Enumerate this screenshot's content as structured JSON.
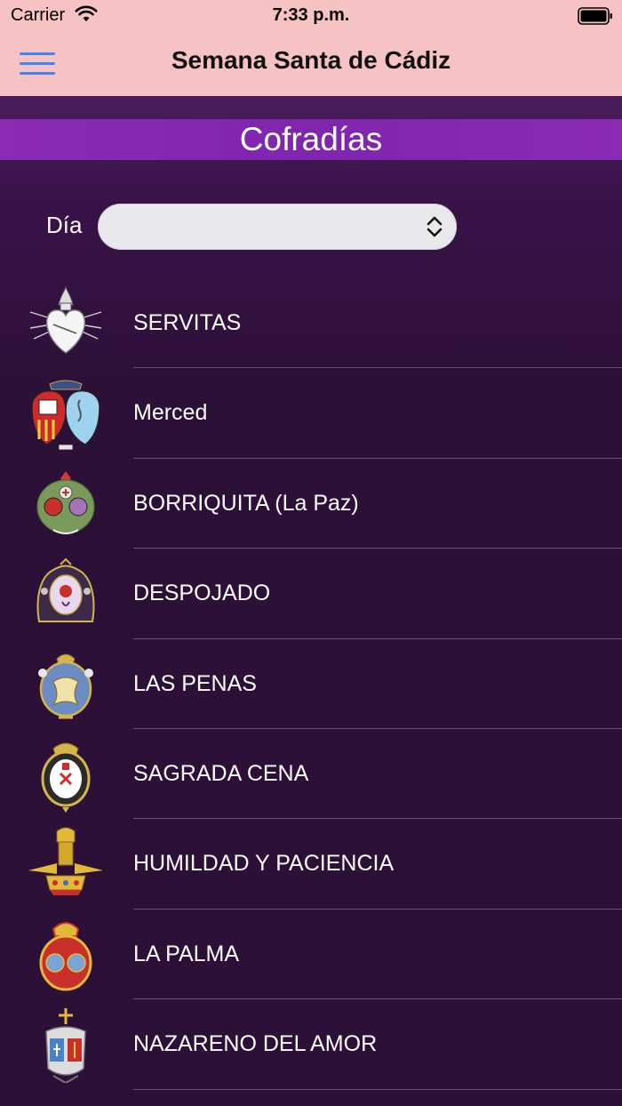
{
  "status_bar": {
    "carrier": "Carrier",
    "time": "7:33 p.m."
  },
  "header": {
    "title": "Semana Santa de Cádiz",
    "menu_icon": "hamburger-menu-icon"
  },
  "section": {
    "title": "Cofradías"
  },
  "filter": {
    "label": "Día",
    "selected": ""
  },
  "cofradias": [
    {
      "name": "SERVITAS",
      "icon": "servitas-emblem-icon"
    },
    {
      "name": "Merced",
      "icon": "merced-emblem-icon"
    },
    {
      "name": "BORRIQUITA (La Paz)",
      "icon": "borriquita-emblem-icon"
    },
    {
      "name": "DESPOJADO",
      "icon": "despojado-emblem-icon"
    },
    {
      "name": "LAS PENAS",
      "icon": "las-penas-emblem-icon"
    },
    {
      "name": "SAGRADA CENA",
      "icon": "sagrada-cena-emblem-icon"
    },
    {
      "name": "HUMILDAD Y PACIENCIA",
      "icon": "humildad-paciencia-emblem-icon"
    },
    {
      "name": "LA PALMA",
      "icon": "la-palma-emblem-icon"
    },
    {
      "name": "NAZARENO DEL AMOR",
      "icon": "nazareno-amor-emblem-icon"
    }
  ],
  "colors": {
    "header_bg": "#f6c2c3",
    "banner_bg": "#8b2bb5",
    "list_bg": "#2d1038",
    "menu_icon": "#3e84f4"
  }
}
